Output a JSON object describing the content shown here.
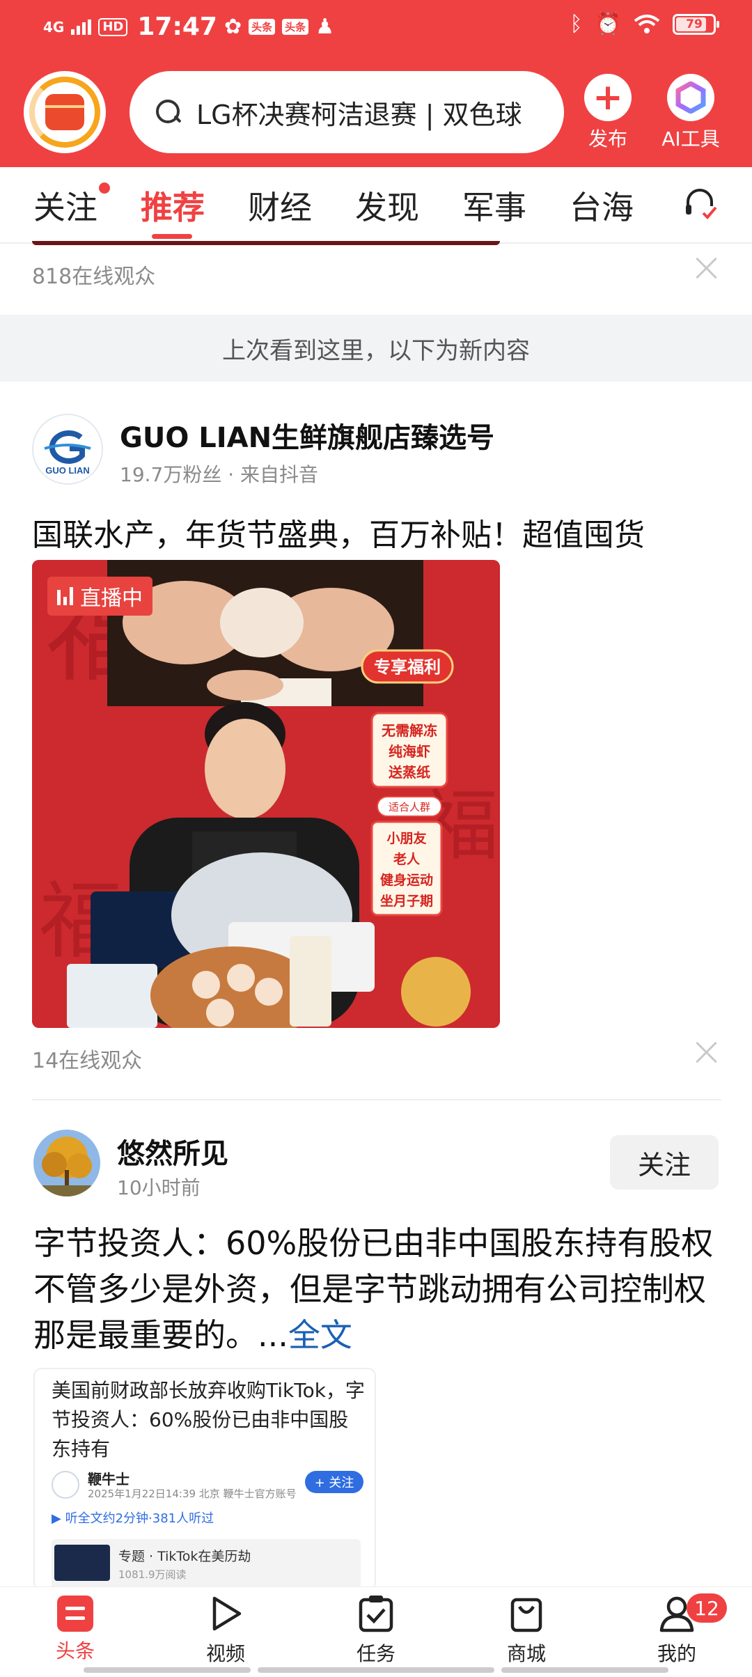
{
  "status_bar": {
    "network": "4G",
    "hd": "HD",
    "time": "17:47",
    "app_badge_1": "头条",
    "app_badge_2": "头条",
    "battery": "79"
  },
  "header": {
    "search_text": "LG杯决赛柯洁退赛 | 双色球",
    "publish_label": "发布",
    "ai_label": "AI工具"
  },
  "tabs": [
    "关注",
    "推荐",
    "财经",
    "发现",
    "军事",
    "台海"
  ],
  "feed": {
    "prev_viewers": "818在线观众",
    "new_content_banner": "上次看到这里，以下为新内容",
    "post1": {
      "author": "GUO LIAN生鲜旗舰店臻选号",
      "avatar_text": "GUO LIAN",
      "meta": "19.7万粉丝 · 来自抖音",
      "title": "国联水产，年货节盛典，百万补贴！超值囤货",
      "live_badge": "直播中",
      "promo_1": "专享福利",
      "promo_2": "无需解冻\n纯海虾\n送蒸纸",
      "promo_3": "适合人群",
      "promo_4": "小朋友\n老人\n健身运动\n坐月子期",
      "viewers": "14在线观众"
    },
    "post2": {
      "author": "悠然所见",
      "meta": "10小时前",
      "follow": "关注",
      "text": "字节投资人：60%股份已由非中国股东持有股权不管多少是外资，但是字节跳动拥有公司控制权那是最重要的。...",
      "full_text_link": "全文",
      "card": {
        "title": "美国前财政部长放弃收购TikTok，字节投资人：60%股份已由非中国股东持有",
        "author": "鞭牛士",
        "date": "2025年1月22日14:39 北京 鞭牛士官方账号",
        "follow": "+ 关注",
        "listen": "▶ 听全文约2分钟·381人听过",
        "topic_title": "专题 · TikTok在美历劫",
        "topic_reads": "1081.9万阅读"
      }
    }
  },
  "bottom_nav": [
    {
      "label": "头条",
      "icon": "toutiao-icon",
      "active": true
    },
    {
      "label": "视频",
      "icon": "play-icon"
    },
    {
      "label": "任务",
      "icon": "task-check-icon"
    },
    {
      "label": "商城",
      "icon": "shopping-bag-icon"
    },
    {
      "label": "我的",
      "icon": "person-icon"
    }
  ],
  "mine_badge": "12",
  "colors": {
    "brand_red": "#f04142",
    "link_blue": "#1a5fb4"
  }
}
